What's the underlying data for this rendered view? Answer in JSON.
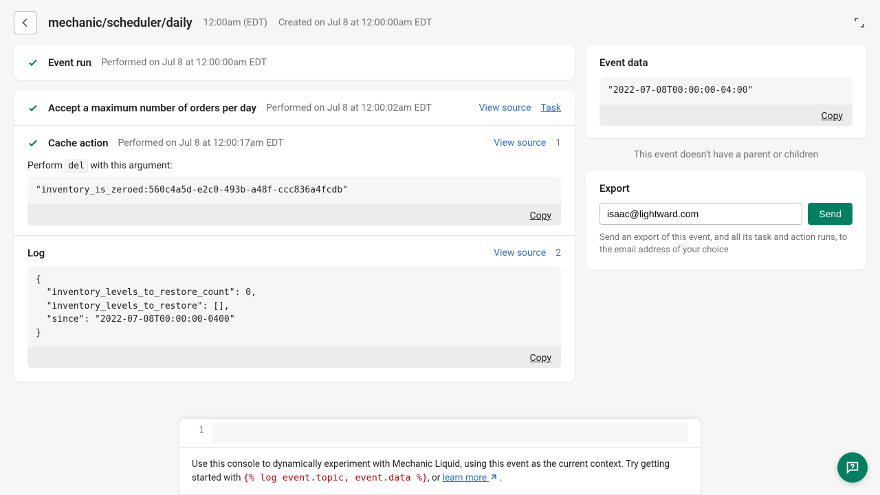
{
  "header": {
    "title": "mechanic/scheduler/daily",
    "time": "12:00am (EDT)",
    "created": "Created on Jul 8 at 12:00:00am EDT"
  },
  "event_run": {
    "title": "Event run",
    "performed": "Performed on Jul 8 at 12:00:00am EDT"
  },
  "task_run": {
    "title": "Accept a maximum number of orders per day",
    "performed": "Performed on Jul 8 at 12:00:02am EDT",
    "view_source": "View source",
    "task_link": "Task"
  },
  "cache_action": {
    "title": "Cache action",
    "performed": "Performed on Jul 8 at 12:00:17am EDT",
    "view_source": "View source",
    "badge": "1",
    "perform_prefix": "Perform ",
    "perform_cmd": "del",
    "perform_suffix": " with this argument:",
    "argument": "\"inventory_is_zeroed:560c4a5d-e2c0-493b-a48f-ccc836a4fcdb\"",
    "copy": "Copy"
  },
  "log": {
    "title": "Log",
    "view_source": "View source",
    "badge": "2",
    "content": "{\n  \"inventory_levels_to_restore_count\": 0,\n  \"inventory_levels_to_restore\": [],\n  \"since\": \"2022-07-08T00:00:00-0400\"\n}",
    "copy": "Copy"
  },
  "event_data": {
    "title": "Event data",
    "content": "\"2022-07-08T00:00:00-04:00\"",
    "copy": "Copy"
  },
  "parent_msg": "This event doesn't have a parent or children",
  "export": {
    "title": "Export",
    "email": "isaac@lightward.com",
    "send": "Send",
    "desc": "Send an export of this event, and all its task and action runs, to the email address of your choice"
  },
  "console": {
    "line_no": "1",
    "hint_prefix": "Use this console to dynamically experiment with Mechanic Liquid, using this event as the current context. Try getting started with ",
    "hint_code": "{% log event.topic, event.data %}",
    "hint_mid": ", or ",
    "learn_more": "learn more",
    "hint_end": " ."
  }
}
